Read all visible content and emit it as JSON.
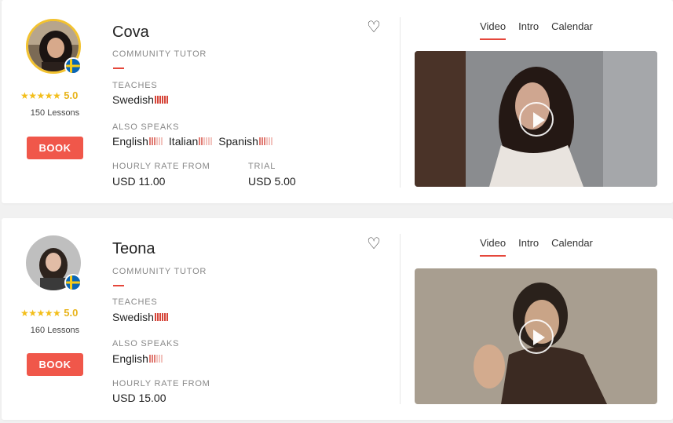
{
  "tutors": [
    {
      "name": "Cova",
      "type": "COMMUNITY TUTOR",
      "rating": "5.0",
      "stars": "★★★★★",
      "lessons": "150 Lessons",
      "book_label": "BOOK",
      "teaches_label": "TEACHES",
      "teaches": "Swedish",
      "speaks_label": "ALSO SPEAKS",
      "speaks": [
        "English",
        "Italian",
        "Spanish"
      ],
      "rate_label": "HOURLY RATE FROM",
      "rate": "USD 11.00",
      "trial_label": "TRIAL",
      "trial": "USD 5.00",
      "tabs": [
        "Video",
        "Intro",
        "Calendar"
      ]
    },
    {
      "name": "Teona",
      "type": "COMMUNITY TUTOR",
      "rating": "5.0",
      "stars": "★★★★★",
      "lessons": "160 Lessons",
      "book_label": "BOOK",
      "teaches_label": "TEACHES",
      "teaches": "Swedish",
      "speaks_label": "ALSO SPEAKS",
      "speaks": [
        "English"
      ],
      "rate_label": "HOURLY RATE FROM",
      "rate": "USD 15.00",
      "tabs": [
        "Video",
        "Intro",
        "Calendar"
      ]
    }
  ],
  "icons": {
    "heart": "heart-icon",
    "play": "play-icon",
    "flag": "sweden-flag-icon"
  },
  "colors": {
    "accent": "#f0574a",
    "star": "#f3be1a",
    "avatar_ring": "#f2c230"
  }
}
